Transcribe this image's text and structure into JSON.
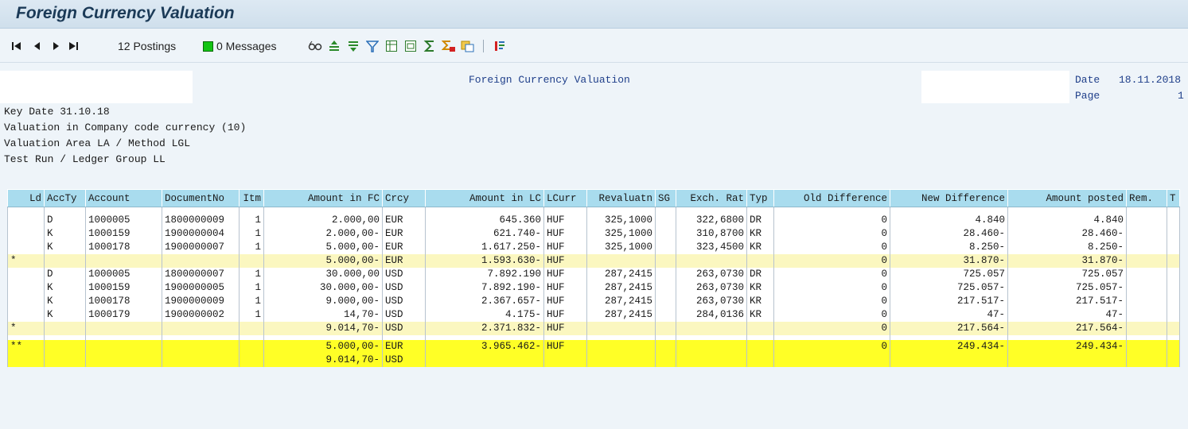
{
  "title": "Foreign Currency Valuation",
  "toolbar": {
    "postings": "12 Postings",
    "messages": "0 Messages",
    "icons": [
      "first-page-icon",
      "prev-page-icon",
      "next-page-icon",
      "last-page-icon",
      "glasses-icon",
      "sort-ascending-icon",
      "sort-descending-icon",
      "filter-icon",
      "export-icon",
      "print-icon",
      "sum-icon",
      "subtotal-icon",
      "layout-icon",
      "columns-icon"
    ]
  },
  "report": {
    "header_title": "Foreign Currency Valuation",
    "date_label": "Date",
    "date_value": "18.11.2018",
    "page_label": "Page",
    "page_value": "1",
    "info_lines": [
      "Key Date 31.10.18",
      "Valuation in Company code currency (10)",
      "Valuation Area LA / Method LGL",
      "Test Run / Ledger Group LL"
    ]
  },
  "table": {
    "columns": [
      "Ld",
      "AccTy",
      "Account",
      "DocumentNo",
      "Itm",
      "Amount in FC",
      "Crcy",
      "Amount in LC",
      "LCurr",
      "Revaluatn",
      "SG",
      "Exch. Rat",
      "Typ",
      "Old Difference",
      "New Difference",
      "Amount posted",
      "Rem.",
      "T"
    ],
    "rows": [
      {
        "kind": "row",
        "cells": [
          "",
          "D",
          "1000005",
          "1800000009",
          "1",
          "2.000,00",
          "EUR",
          "645.360",
          "HUF",
          "325,1000",
          "",
          "322,6800",
          "DR",
          "0",
          "4.840",
          "4.840",
          "",
          ""
        ]
      },
      {
        "kind": "row",
        "cells": [
          "",
          "K",
          "1000159",
          "1900000004",
          "1",
          "2.000,00-",
          "EUR",
          "621.740-",
          "HUF",
          "325,1000",
          "",
          "310,8700",
          "KR",
          "0",
          "28.460-",
          "28.460-",
          "",
          ""
        ]
      },
      {
        "kind": "row",
        "cells": [
          "",
          "K",
          "1000178",
          "1900000007",
          "1",
          "5.000,00-",
          "EUR",
          "1.617.250-",
          "HUF",
          "325,1000",
          "",
          "323,4500",
          "KR",
          "0",
          "8.250-",
          "8.250-",
          "",
          ""
        ]
      },
      {
        "kind": "sub",
        "cells": [
          "*",
          "",
          "",
          "",
          "",
          "5.000,00-",
          "EUR",
          "1.593.630-",
          "HUF",
          "",
          "",
          "",
          "",
          "0",
          "31.870-",
          "31.870-",
          "",
          ""
        ]
      },
      {
        "kind": "row",
        "cells": [
          "",
          "D",
          "1000005",
          "1800000007",
          "1",
          "30.000,00",
          "USD",
          "7.892.190",
          "HUF",
          "287,2415",
          "",
          "263,0730",
          "DR",
          "0",
          "725.057",
          "725.057",
          "",
          ""
        ]
      },
      {
        "kind": "row",
        "cells": [
          "",
          "K",
          "1000159",
          "1900000005",
          "1",
          "30.000,00-",
          "USD",
          "7.892.190-",
          "HUF",
          "287,2415",
          "",
          "263,0730",
          "KR",
          "0",
          "725.057-",
          "725.057-",
          "",
          ""
        ]
      },
      {
        "kind": "row",
        "cells": [
          "",
          "K",
          "1000178",
          "1900000009",
          "1",
          "9.000,00-",
          "USD",
          "2.367.657-",
          "HUF",
          "287,2415",
          "",
          "263,0730",
          "KR",
          "0",
          "217.517-",
          "217.517-",
          "",
          ""
        ]
      },
      {
        "kind": "row",
        "cells": [
          "",
          "K",
          "1000179",
          "1900000002",
          "1",
          "14,70-",
          "USD",
          "4.175-",
          "HUF",
          "287,2415",
          "",
          "284,0136",
          "KR",
          "0",
          "47-",
          "47-",
          "",
          ""
        ]
      },
      {
        "kind": "sub",
        "cells": [
          "*",
          "",
          "",
          "",
          "",
          "9.014,70-",
          "USD",
          "2.371.832-",
          "HUF",
          "",
          "",
          "",
          "",
          "0",
          "217.564-",
          "217.564-",
          "",
          ""
        ]
      },
      {
        "kind": "total",
        "cells": [
          "**",
          "",
          "",
          "",
          "",
          "5.000,00-",
          "EUR",
          "3.965.462-",
          "HUF",
          "",
          "",
          "",
          "",
          "0",
          "249.434-",
          "249.434-",
          "",
          ""
        ]
      },
      {
        "kind": "total",
        "cells": [
          "",
          "",
          "",
          "",
          "",
          "9.014,70-",
          "USD",
          "",
          "",
          "",
          "",
          "",
          "",
          "",
          "",
          "",
          "",
          ""
        ]
      }
    ]
  }
}
